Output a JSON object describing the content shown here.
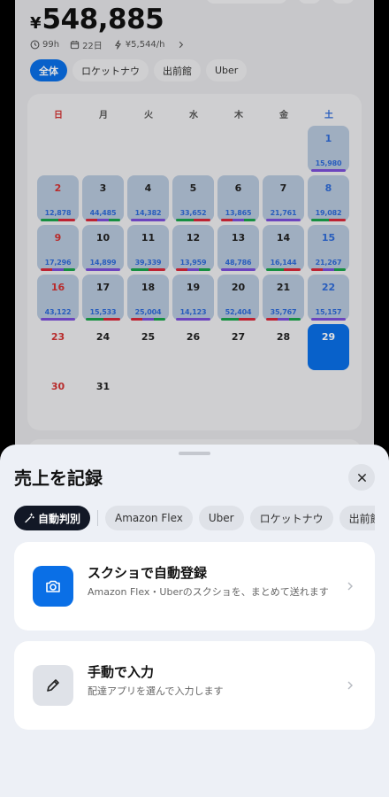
{
  "summary": {
    "currency": "¥",
    "total": "548,885",
    "hours": "99h",
    "days": "22日",
    "hourly": "¥5,544/h"
  },
  "filters": [
    "全体",
    "ロケットナウ",
    "出前館",
    "Uber"
  ],
  "calendar": {
    "weekdays": [
      "日",
      "月",
      "火",
      "水",
      "木",
      "金",
      "土"
    ],
    "days": [
      {
        "d": "1",
        "v": "15,980"
      },
      {
        "d": "2",
        "v": "12,878"
      },
      {
        "d": "3",
        "v": "44,485"
      },
      {
        "d": "4",
        "v": "14,382"
      },
      {
        "d": "5",
        "v": "33,652"
      },
      {
        "d": "6",
        "v": "13,865"
      },
      {
        "d": "7",
        "v": "21,761"
      },
      {
        "d": "8",
        "v": "19,082"
      },
      {
        "d": "9",
        "v": "17,296"
      },
      {
        "d": "10",
        "v": "14,899"
      },
      {
        "d": "11",
        "v": "39,339"
      },
      {
        "d": "12",
        "v": "13,959"
      },
      {
        "d": "13",
        "v": "48,786"
      },
      {
        "d": "14",
        "v": "16,144"
      },
      {
        "d": "15",
        "v": "21,267"
      },
      {
        "d": "16",
        "v": "43,122"
      },
      {
        "d": "17",
        "v": "15,533"
      },
      {
        "d": "18",
        "v": "25,004"
      },
      {
        "d": "19",
        "v": "14,123"
      },
      {
        "d": "20",
        "v": "52,404"
      },
      {
        "d": "21",
        "v": "35,767"
      },
      {
        "d": "22",
        "v": "15,157"
      },
      {
        "d": "23",
        "v": ""
      },
      {
        "d": "24",
        "v": ""
      },
      {
        "d": "25",
        "v": ""
      },
      {
        "d": "26",
        "v": ""
      },
      {
        "d": "27",
        "v": ""
      },
      {
        "d": "28",
        "v": ""
      },
      {
        "d": "29",
        "v": ""
      },
      {
        "d": "30",
        "v": ""
      },
      {
        "d": "31",
        "v": ""
      }
    ],
    "today": "29"
  },
  "sheet": {
    "title": "売上を記録",
    "chips": [
      "自動判別",
      "Amazon Flex",
      "Uber",
      "ロケットナウ",
      "出前館"
    ],
    "options": [
      {
        "title": "スクショで自動登録",
        "desc": "Amazon Flex・Uberのスクショを、まとめて送れます"
      },
      {
        "title": "手動で入力",
        "desc": "配達アプリを選んで入力します"
      }
    ]
  },
  "colors": {
    "accent": "#0a6fe6",
    "sunday": "#d23333",
    "saturday": "#2f6bd8",
    "platform_purple": "#7b4fd9",
    "platform_green": "#1aa34a",
    "platform_red": "#d8283a"
  }
}
